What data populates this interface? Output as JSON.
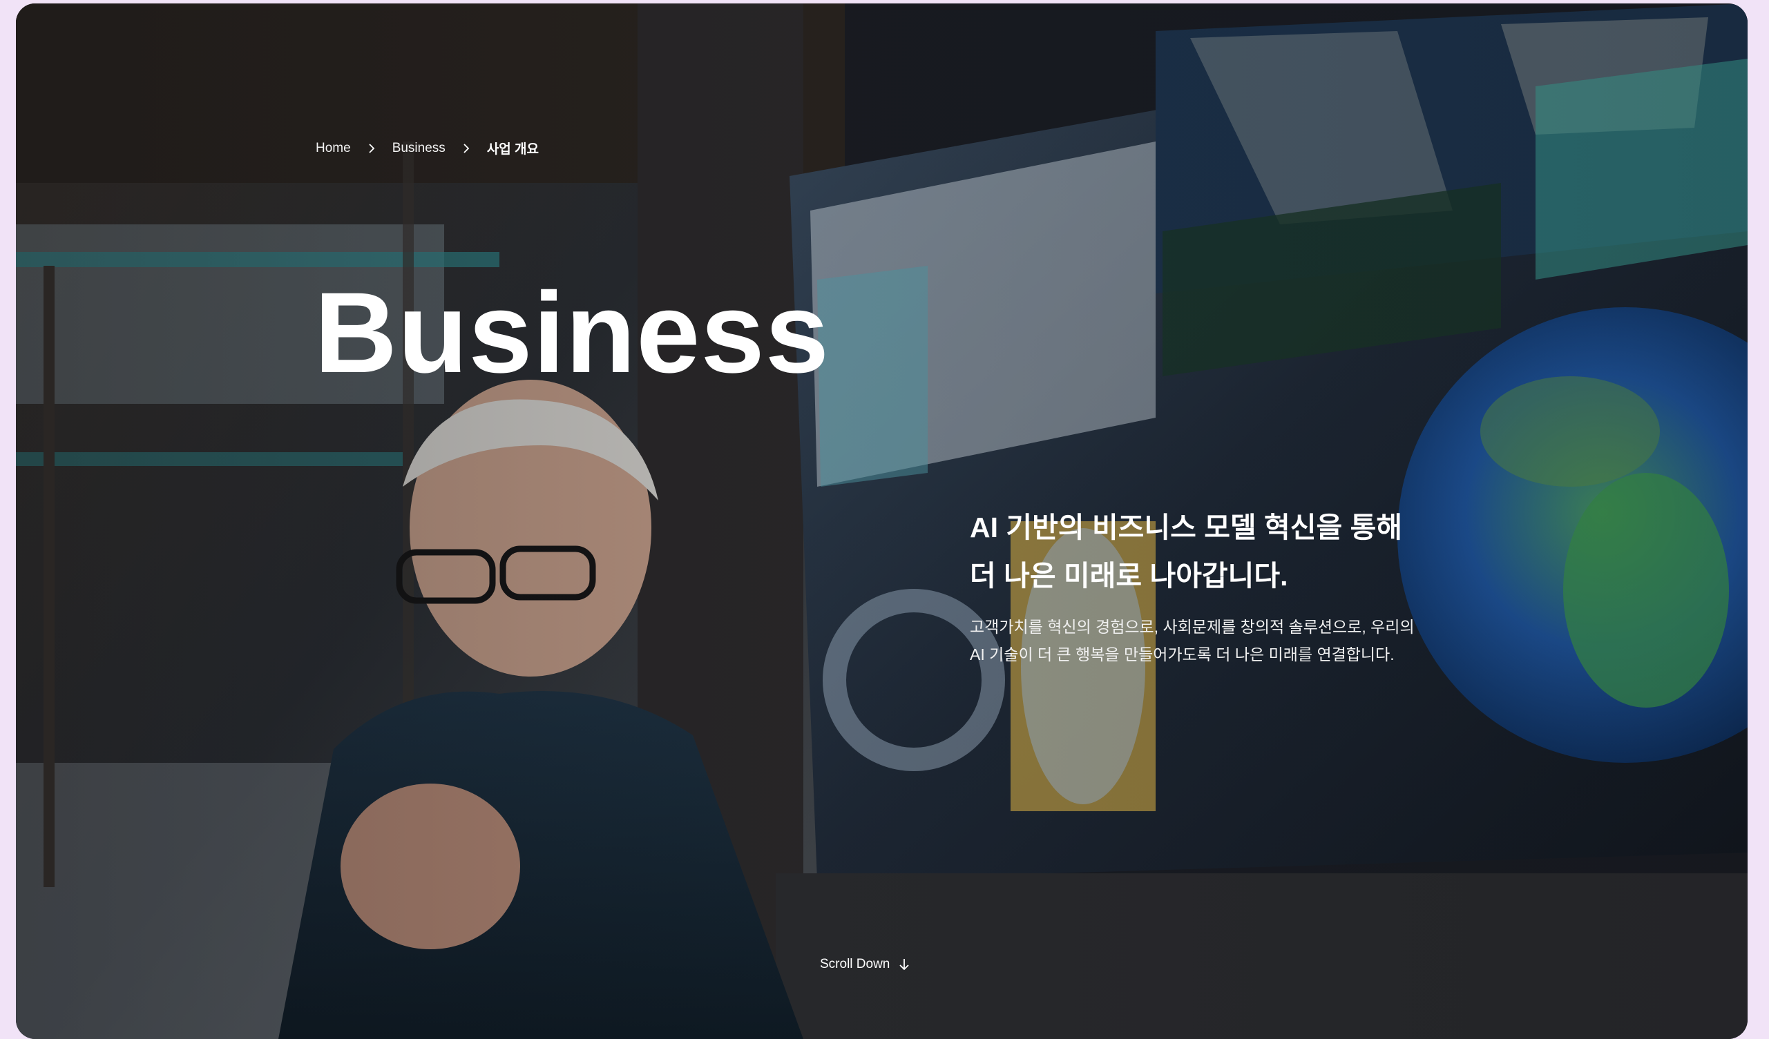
{
  "breadcrumb": {
    "items": [
      "Home",
      "Business",
      "사업 개요"
    ]
  },
  "hero": {
    "title": "Business",
    "headline": "AI 기반의 비즈니스 모델 혁신을 통해\n더 나은 미래로 나아갑니다.",
    "description": "고객가치를 혁신의 경험으로, 사회문제를 창의적 솔루션으로, 우리의\nAI 기술이 더 큰 행복을 만들어가도록 더 나은 미래를 연결합니다.",
    "scroll_label": "Scroll Down"
  },
  "icons": {
    "breadcrumb_separator": "chevron-right-icon",
    "scroll": "arrow-down-icon"
  },
  "colors": {
    "page_background": "#f1e3f7",
    "text": "#ffffff"
  }
}
